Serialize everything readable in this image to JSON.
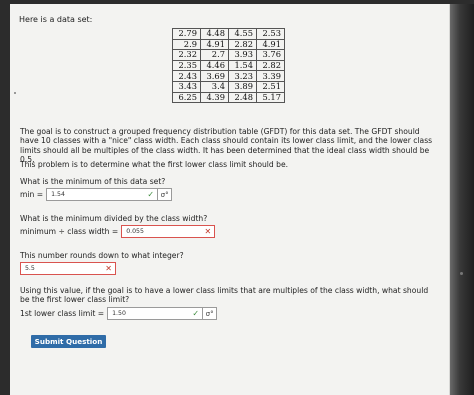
{
  "intro_text": "Here is a data set:",
  "data_table": [
    [
      "2.79",
      "4.48",
      "4.55",
      "2.53"
    ],
    [
      "2.9",
      "4.91",
      "2.82",
      "4.91"
    ],
    [
      "2.32",
      "2.7",
      "3.93",
      "3.76"
    ],
    [
      "2.35",
      "4.46",
      "1.54",
      "2.82"
    ],
    [
      "2.43",
      "3.69",
      "3.23",
      "3.39"
    ],
    [
      "3.43",
      "3.4",
      "3.89",
      "2.51"
    ],
    [
      "6.25",
      "4.39",
      "2.48",
      "5.17"
    ]
  ],
  "paragraph1": "The goal is to construct a grouped frequency distribution table (GFDT) for this data set. The GFDT should have 10 classes with a \"nice\" class width. Each class should contain its lower class limit, and the lower class limits should all be multiples of the class width. It has been determined that the ideal class width should be 0.5.",
  "paragraph2": "This problem is to determine what the first lower class limit should be.",
  "q1": {
    "question": "What is the minimum of this data set?",
    "label": "min =",
    "value": "1.54",
    "status_icon": "check-icon",
    "extra_icon": "sigma-icon"
  },
  "q2": {
    "question": "What is the minimum divided by the class width?",
    "label": "minimum ÷ class width =",
    "value": "0.055",
    "status_icon": "x-icon"
  },
  "q3": {
    "question": "This number rounds down to what integer?",
    "value": "5.5",
    "status_icon": "x-icon"
  },
  "q4": {
    "question": "Using this value, if the goal is to have a lower class limits that are multiples of the class width, what should be the first lower class limit?",
    "label": "1st lower class limit =",
    "value": "1.50",
    "status_icon": "check-icon",
    "extra_icon": "sigma-icon"
  },
  "submit_label": "Submit Question",
  "colors": {
    "correct": "#3d8b3d",
    "incorrect": "#c0392b",
    "button": "#2f6ca8"
  }
}
